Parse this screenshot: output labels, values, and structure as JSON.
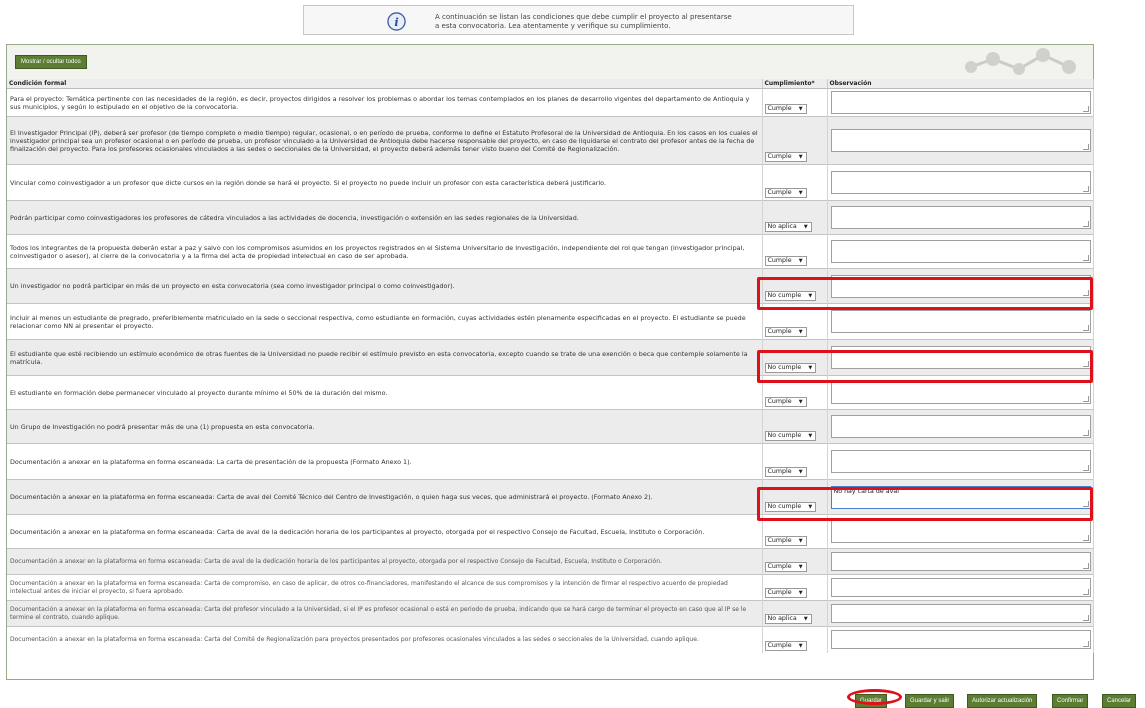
{
  "notice": {
    "icon": "info-icon",
    "line1": "A continuación se listan las condiciones que debe cumplir el proyecto al presentarse",
    "line2": "a esta convocatoria. Lea atentamente y verifique su cumplimiento."
  },
  "toggle_label": "Mostrar / ocultar todos",
  "headers": {
    "condition": "Condición formal",
    "compliance": "Cumplimiento*",
    "observation": "Observación"
  },
  "rows": [
    {
      "text": "Para el proyecto: Temática pertinente con las necesidades de la región, es decir, proyectos dirigidos a resolver los problemas o abordar los temas contemplados en los planes de desarrollo vigentes del departamento de Antioquia y sus municipios, y según lo estipulado en el objetivo de la convocatoria.",
      "value": "Cumple",
      "obs": ""
    },
    {
      "text": "El Investigador Principal (IP), deberá ser profesor (de tiempo completo o medio tiempo) regular, ocasional, o en período de prueba, conforme lo define el Estatuto Profesoral de la Universidad de Antioquia. En los casos en los cuales el investigador principal sea un profesor ocasional o en período de prueba, un profesor vinculado a la Universidad de Antioquia debe hacerse responsable del proyecto, en caso de liquidarse el contrato del profesor antes de la fecha de finalización del proyecto. Para los profesores ocasionales vinculados a las sedes o seccionales de la Universidad, el proyecto deberá además tener visto bueno del Comité de Regionalización.",
      "value": "Cumple",
      "obs": ""
    },
    {
      "text": "Vincular como coinvestigador a un profesor que dicte cursos en la región donde se hará el proyecto. Si el proyecto no puede incluir un profesor con esta característica deberá justificarlo.",
      "value": "Cumple",
      "obs": ""
    },
    {
      "text": "Podrán participar como coinvestigadores los profesores de cátedra vinculados a las actividades de docencia, investigación o extensión en las sedes regionales de la Universidad.",
      "value": "No aplica",
      "obs": ""
    },
    {
      "text": "Todos los integrantes de la propuesta deberán estar a paz y salvo con los compromisos asumidos en los proyectos registrados en el Sistema Universitario de Investigación, independiente del rol que tengan (investigador principal, coinvestigador o asesor), al cierre de la convocatoria y a la firma del acta de propiedad intelectual en caso de ser aprobada.",
      "value": "Cumple",
      "obs": ""
    },
    {
      "text": "Un investigador no podrá participar en más de un proyecto en esta convocatoria (sea como investigador principal o como coinvestigador).",
      "value": "No cumple",
      "obs": ""
    },
    {
      "text": "Incluir al menos un estudiante de pregrado, preferiblemente matriculado en la sede o seccional respectiva, como estudiante en formación, cuyas actividades estén plenamente especificadas en el proyecto. El estudiante se puede relacionar como NN al presentar el proyecto.",
      "value": "Cumple",
      "obs": ""
    },
    {
      "text": "El estudiante que esté recibiendo un estímulo económico de otras fuentes de la Universidad no puede recibir el estímulo previsto en esta convocatoria, excepto cuando se trate de una exención o beca que contemple solamente la matrícula.",
      "value": "No cumple",
      "obs": ""
    },
    {
      "text": "El estudiante en formación debe permanecer vinculado al proyecto durante mínimo el 50% de la duración del mismo.",
      "value": "Cumple",
      "obs": ""
    },
    {
      "text": "Un Grupo de Investigación no podrá presentar más de una (1) propuesta en esta convocatoria.",
      "value": "No cumple",
      "obs": ""
    },
    {
      "text": "Documentación a anexar en la plataforma en forma escaneada: La carta de presentación de la propuesta (Formato Anexo 1).",
      "value": "Cumple",
      "obs": ""
    },
    {
      "text": "Documentación a anexar en la plataforma en forma escaneada: Carta de aval del Comité Técnico del Centro de Investigación, o quien haga sus veces, que administrará el proyecto. (Formato Anexo 2).",
      "value": "No cumple",
      "obs": "No hay carta de aval"
    },
    {
      "text": "Documentación a anexar en la plataforma en forma escaneada: Carta de aval de la dedicación horaria de los participantes al proyecto, otorgada por el respectivo Consejo de Facultad, Escuela, Instituto o Corporación.",
      "value": "Cumple",
      "obs": ""
    },
    {
      "text": "Documentación a anexar en la plataforma en forma escaneada: Carta de aval de la dedicación horaria de los participantes al proyecto, otorgada por el respectivo Consejo de Facultad, Escuela, Instituto o Corporación.",
      "value": "Cumple",
      "obs": ""
    },
    {
      "text": "Documentación a anexar en la plataforma en forma escaneada: Carta de compromiso, en caso de aplicar, de otros co-financiadores, manifestando el alcance de sus compromisos y la intención de firmar el respectivo acuerdo de propiedad intelectual antes de iniciar el proyecto, si fuera aprobado.",
      "value": "Cumple",
      "obs": ""
    },
    {
      "text": "Documentación a anexar en la plataforma en forma escaneada: Carta del profesor vinculado a la Universidad, si el IP es profesor ocasional o está en periodo de prueba, indicando que se hará cargo de terminar el proyecto en caso que al IP se le termine el contrato, cuando aplique.",
      "value": "No aplica",
      "obs": ""
    },
    {
      "text": "Documentación a anexar en la plataforma en forma escaneada: Carta del Comité de Regionalización para proyectos presentados por profesores ocasionales vinculados a las sedes o seccionales de la Universidad, cuando aplique.",
      "value": "Cumple",
      "obs": ""
    }
  ],
  "footer": {
    "save": "Guardar",
    "save_exit": "Guardar y salir",
    "authorize": "Autorizar actualización",
    "confirm": "Confirmar",
    "cancel": "Cancelar"
  },
  "colors": {
    "button_green": "#5c7d33",
    "highlight_red": "#e0101a"
  }
}
